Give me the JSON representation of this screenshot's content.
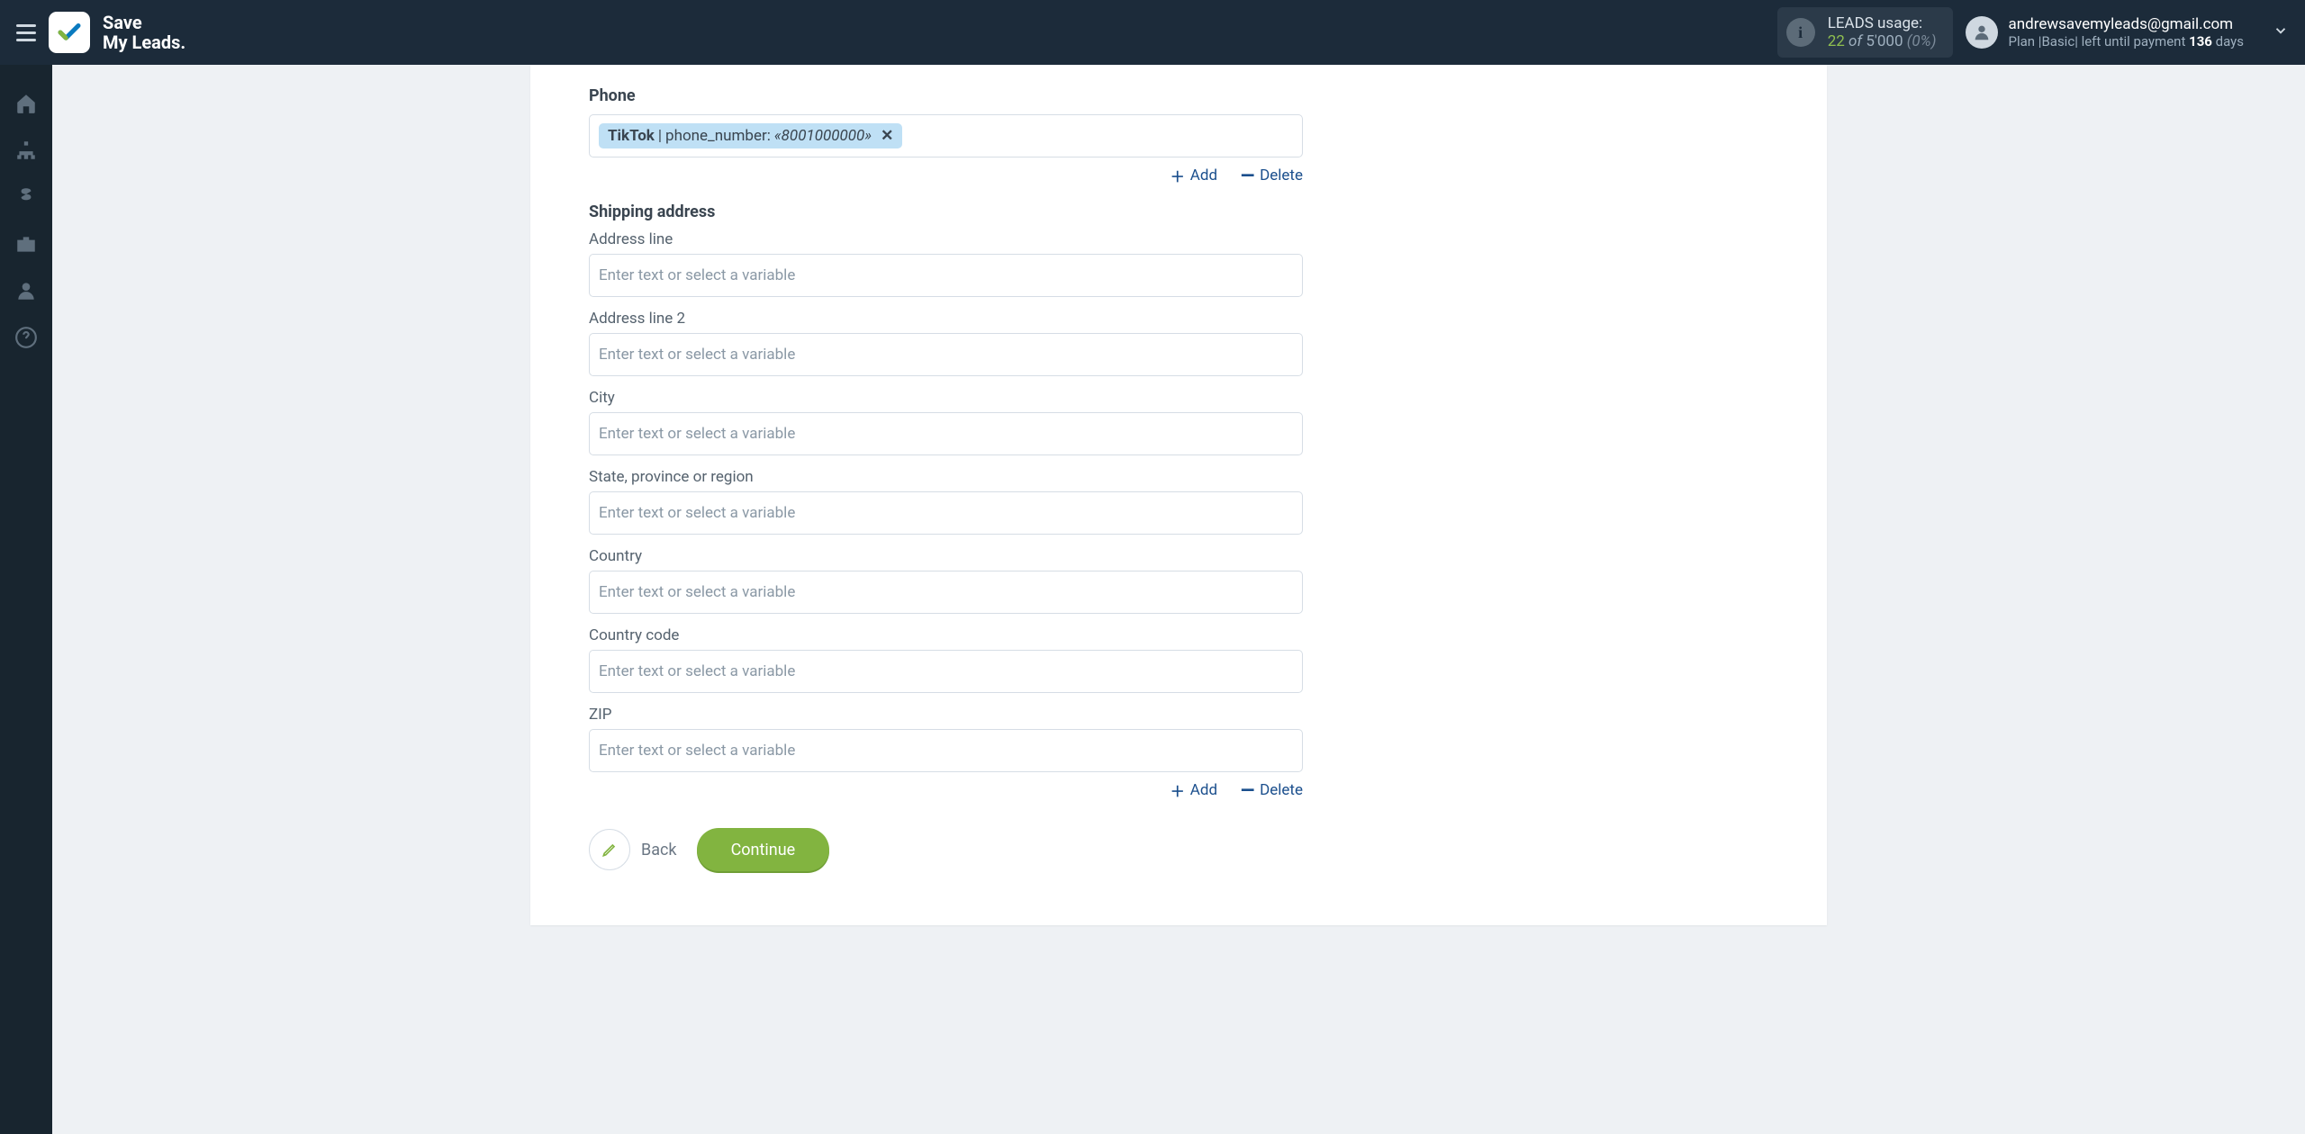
{
  "brand": {
    "line1": "Save",
    "line2": "My Leads."
  },
  "leads": {
    "label": "LEADS usage:",
    "count": "22",
    "of": "of",
    "total": "5'000",
    "pct": "(0%)"
  },
  "account": {
    "email": "andrewsavemyleads@gmail.com",
    "plan_prefix": "Plan |",
    "plan_name": "Basic",
    "plan_mid": "| left until payment ",
    "days": "136",
    "days_word": " days"
  },
  "form": {
    "phone": {
      "label": "Phone",
      "chip_source": "TikTok",
      "chip_sep": " | ",
      "chip_field": "phone_number: ",
      "chip_value": "«8001000000»"
    },
    "shipping_header": "Shipping address",
    "placeholder": "Enter text or select a variable",
    "fields": {
      "addr1": "Address line",
      "addr2": "Address line 2",
      "city": "City",
      "state": "State, province or region",
      "country": "Country",
      "ccode": "Country code",
      "zip": "ZIP"
    },
    "actions": {
      "add": "Add",
      "delete": "Delete"
    },
    "buttons": {
      "back": "Back",
      "continue": "Continue"
    }
  }
}
